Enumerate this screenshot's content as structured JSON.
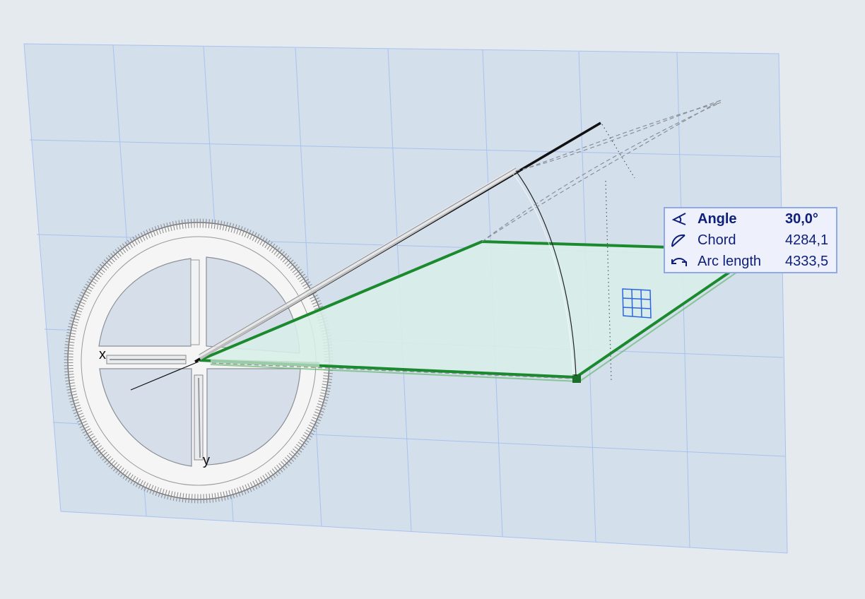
{
  "protractor": {
    "x_axis_label": "x",
    "y_axis_label": "y"
  },
  "tracker": {
    "rows": [
      {
        "icon": "angle-icon",
        "label": "Angle",
        "value": "30,0°",
        "bold": true
      },
      {
        "icon": "chord-icon",
        "label": "Chord",
        "value": "4284,1",
        "bold": false
      },
      {
        "icon": "arc-length-icon",
        "label": "Arc length",
        "value": "4333,5",
        "bold": false
      }
    ]
  },
  "colors": {
    "background": "#e5eaee",
    "working_plane": "#d4dfec",
    "grid_lines": "#a9c1f0",
    "slab_fill": "#d8efe8",
    "slab_edge": "#1b8a2e",
    "tracker_border": "#8ea8e8",
    "tracker_text": "#0d1f7a"
  }
}
